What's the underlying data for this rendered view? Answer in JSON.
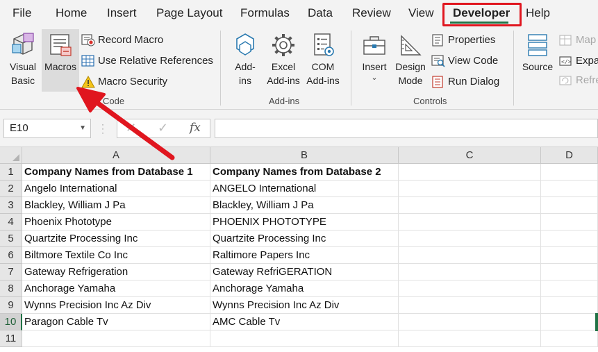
{
  "menu": {
    "tabs": [
      "File",
      "Home",
      "Insert",
      "Page Layout",
      "Formulas",
      "Data",
      "Review",
      "View",
      "Developer",
      "Help"
    ],
    "active": "Developer"
  },
  "ribbon": {
    "code": {
      "visual_basic": "Visual\nBasic",
      "macros": "Macros",
      "record_macro": "Record Macro",
      "relative_refs": "Use Relative References",
      "macro_security": "Macro Security",
      "group_label": "Code"
    },
    "addins": {
      "addins": "Add-\nins",
      "excel_addins": "Excel\nAdd-ins",
      "com_addins": "COM\nAdd-ins",
      "group_label": "Add-ins"
    },
    "controls": {
      "insert": "Insert",
      "design_mode": "Design\nMode",
      "properties": "Properties",
      "view_code": "View Code",
      "run_dialog": "Run Dialog",
      "group_label": "Controls"
    },
    "xml": {
      "source": "Source",
      "map": "Map",
      "expand": "Expa",
      "refresh": "Refre"
    }
  },
  "formula_bar": {
    "name_box": "E10",
    "fx": "fx",
    "value": ""
  },
  "sheet": {
    "columns": [
      "A",
      "B",
      "C",
      "D"
    ],
    "rows": [
      {
        "num": "1",
        "a": "Company Names from Database 1",
        "b": "Company Names from Database 2"
      },
      {
        "num": "2",
        "a": "Angelo International",
        "b": "ANGELO International"
      },
      {
        "num": "3",
        "a": "Blackley, William J Pa",
        "b": "Blackley, William J Pa"
      },
      {
        "num": "4",
        "a": "Phoenix Phototype",
        "b": "PHOENIX PHOTOTYPE"
      },
      {
        "num": "5",
        "a": "Quartzite Processing Inc",
        "b": "Quartzite Processing Inc"
      },
      {
        "num": "6",
        "a": "Biltmore Textile Co Inc",
        "b": "Raltimore Papers Inc"
      },
      {
        "num": "7",
        "a": "Gateway Refrigeration",
        "b": "Gateway RefriGERATION"
      },
      {
        "num": "8",
        "a": "Anchorage Yamaha",
        "b": "Anchorage Yamaha"
      },
      {
        "num": "9",
        "a": "Wynns Precision Inc Az Div",
        "b": "Wynns Precision Inc Az Div"
      },
      {
        "num": "10",
        "a": "Paragon Cable Tv",
        "b": "AMC Cable Tv"
      },
      {
        "num": "11",
        "a": "",
        "b": ""
      }
    ]
  },
  "colors": {
    "accent": "#217346",
    "highlight_red": "#e0161f"
  }
}
